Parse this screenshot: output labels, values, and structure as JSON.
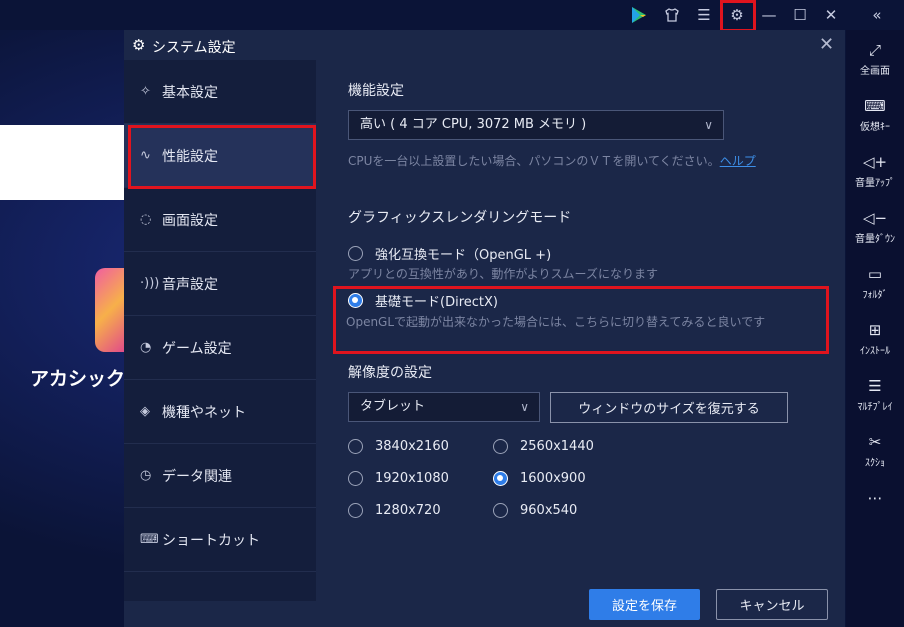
{
  "background_app": {
    "app_name": "アカシックレ"
  },
  "topbar": {
    "icons": [
      "play-store-icon",
      "shirt-icon",
      "menu-icon",
      "gear-icon",
      "minimize-icon",
      "maximize-icon",
      "close-icon",
      "collapse-icon"
    ]
  },
  "right_sidebar": {
    "items": [
      {
        "icon": "fullscreen-icon",
        "label": "全画面"
      },
      {
        "icon": "keyboard-icon",
        "label": "仮想ｷｰ"
      },
      {
        "icon": "volume-up-icon",
        "label": "音量ｱｯﾌﾟ"
      },
      {
        "icon": "volume-down-icon",
        "label": "音量ﾀﾞｳﾝ"
      },
      {
        "icon": "folder-icon",
        "label": "ﾌｫﾙﾀﾞ"
      },
      {
        "icon": "install-icon",
        "label": "ｲﾝｽﾄｰﾙ"
      },
      {
        "icon": "multi-instance-icon",
        "label": "ﾏﾙﾁﾌﾟﾚｲ"
      },
      {
        "icon": "scissors-icon",
        "label": "ｽｸｼｮ"
      },
      {
        "icon": "more-icon",
        "label": ""
      }
    ]
  },
  "dialog": {
    "title": "システム設定",
    "nav": [
      {
        "label": "基本設定",
        "icon": "puzzle-icon"
      },
      {
        "label": "性能設定",
        "icon": "pulse-icon",
        "active": true
      },
      {
        "label": "画面設定",
        "icon": "palette-icon"
      },
      {
        "label": "音声設定",
        "icon": "sound-icon"
      },
      {
        "label": "ゲーム設定",
        "icon": "gamepad-icon"
      },
      {
        "label": "機種やネット",
        "icon": "wifi-icon"
      },
      {
        "label": "データ関連",
        "icon": "history-icon"
      },
      {
        "label": "ショートカット",
        "icon": "keyboard-icon"
      }
    ],
    "performance": {
      "title": "機能設定",
      "selected": "高い ( 4 コア CPU, 3072 MB メモリ )",
      "hint": "CPUを一台以上設置したい場合、パソコンのＶＴを開いてください。",
      "help_link": "ヘルプ"
    },
    "graphics": {
      "title": "グラフィックスレンダリングモード",
      "option1_label": "強化互換モード（OpenGL +)",
      "option1_desc": "アプリとの互換性があり、動作がよりスムーズになります",
      "option2_label": "基礎モード(DirectX)",
      "option2_desc": "OpenGLで起動が出来なかった場合には、こちらに切り替えてみると良いです",
      "selected": "option2"
    },
    "resolution": {
      "title": "解像度の設定",
      "selected": "タブレット",
      "restore_button": "ウィンドウのサイズを復元する",
      "options": [
        "3840x2160",
        "2560x1440",
        "1920x1080",
        "1600x900",
        "1280x720",
        "960x540"
      ],
      "selected_option": "1600x900"
    },
    "save_button": "設定を保存",
    "cancel_button": "キャンセル"
  }
}
